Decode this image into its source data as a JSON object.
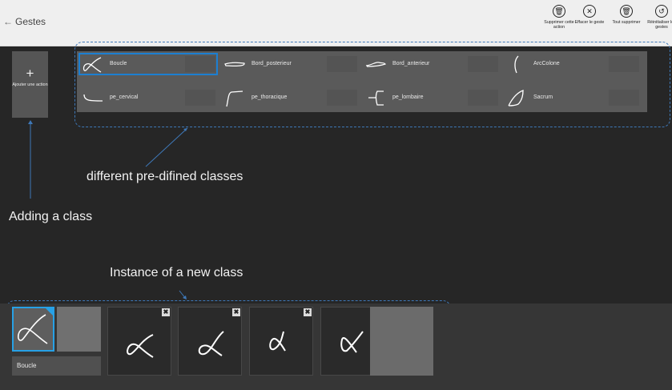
{
  "header": {
    "back_arrow": "←",
    "title": "Gestes",
    "actions": [
      {
        "label": "Supprimer cette action",
        "icon": "trash-icon",
        "glyph": "🗑"
      },
      {
        "label": "Effacer le geste",
        "icon": "close-icon",
        "glyph": "✕"
      },
      {
        "label": "Tout supprimer",
        "icon": "trash-icon",
        "glyph": "🗑"
      },
      {
        "label": "Réinitialiser les gestes",
        "icon": "reset-icon",
        "glyph": "↺"
      }
    ]
  },
  "add_button": {
    "plus": "+",
    "label": "Ajouter une action"
  },
  "classes": [
    {
      "name": "Boucle",
      "icon": "loop-gesture-icon",
      "selected": true
    },
    {
      "name": "Bord_posterieur",
      "icon": "posterior-edge-gesture-icon",
      "selected": false
    },
    {
      "name": "Bord_anterieur",
      "icon": "anterior-edge-gesture-icon",
      "selected": false
    },
    {
      "name": "ArcColone",
      "icon": "arc-gesture-icon",
      "selected": false
    },
    {
      "name": "pe_cervical",
      "icon": "cervical-gesture-icon",
      "selected": false
    },
    {
      "name": "pe_thoracique",
      "icon": "thoracic-gesture-icon",
      "selected": false
    },
    {
      "name": "pe_lombaire",
      "icon": "lumbar-gesture-icon",
      "selected": false
    },
    {
      "name": "Sacrum",
      "icon": "sacrum-gesture-icon",
      "selected": false
    }
  ],
  "annotations": {
    "predefined": "different pre-difined classes",
    "adding": "Adding a class",
    "instance": "Instance of a new class"
  },
  "bottom": {
    "selected_label": "Boucle",
    "instances": [
      {
        "close": "✖",
        "icon": "alpha-gesture-icon"
      },
      {
        "close": "✖",
        "icon": "alpha-gesture-icon"
      },
      {
        "close": "✖",
        "icon": "alpha-gesture-icon"
      },
      {
        "close": "",
        "icon": "alpha-gesture-icon"
      }
    ]
  },
  "colors": {
    "accent": "#27a1e6",
    "selection": "#1c7fd1",
    "annotation_line": "#3e78b8"
  }
}
